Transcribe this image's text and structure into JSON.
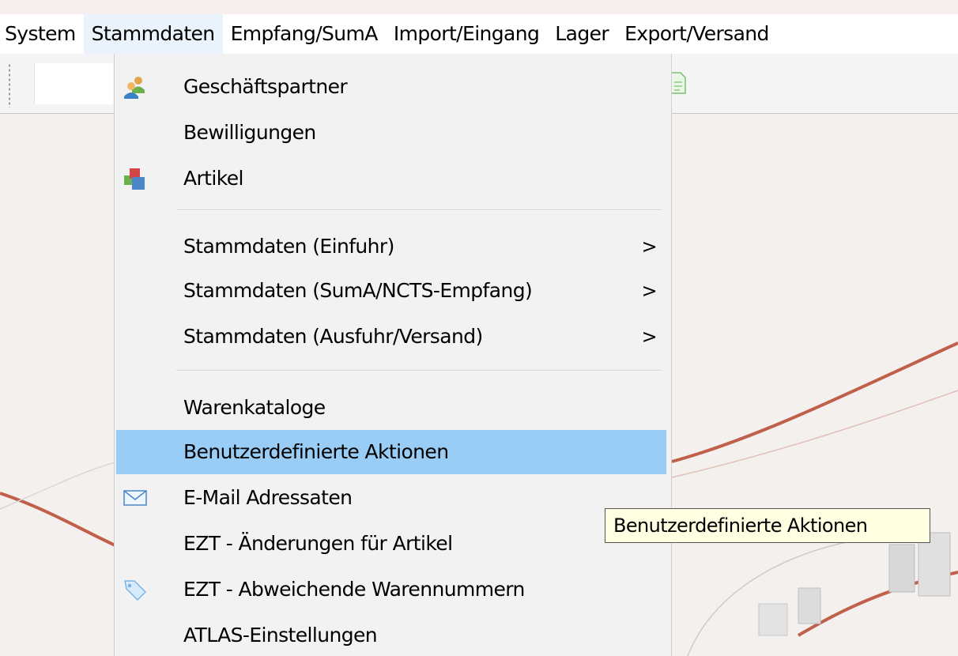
{
  "menubar": {
    "items": [
      {
        "label": "System"
      },
      {
        "label": "Stammdaten"
      },
      {
        "label": "Empfang/SumA"
      },
      {
        "label": "Import/Eingang"
      },
      {
        "label": "Lager"
      },
      {
        "label": "Export/Versand"
      }
    ],
    "active": "Stammdaten"
  },
  "dropdown": {
    "items": [
      {
        "label": "Geschäftspartner",
        "icon": "business-partner-icon"
      },
      {
        "label": "Bewilligungen"
      },
      {
        "label": "Artikel",
        "icon": "articles-cubes-icon"
      },
      {
        "label": "Stammdaten (Einfuhr)",
        "submenu_arrow": ">"
      },
      {
        "label": "Stammdaten (SumA/NCTS-Empfang)",
        "submenu_arrow": ">"
      },
      {
        "label": "Stammdaten (Ausfuhr/Versand)",
        "submenu_arrow": ">"
      },
      {
        "label": "Warenkataloge"
      },
      {
        "label": "Benutzerdefinierte Aktionen",
        "highlighted": true
      },
      {
        "label": "E-Mail Adressaten",
        "icon": "envelope-icon"
      },
      {
        "label": "EZT - Änderungen für Artikel"
      },
      {
        "label": "EZT - Abweichende Warennummern",
        "icon": "tag-icon"
      },
      {
        "label": "ATLAS-Einstellungen"
      }
    ]
  },
  "tooltip": {
    "text": "Benutzerdefinierte Aktionen"
  },
  "colors": {
    "highlight": "#99cdf5",
    "menu_background": "#f2f2f2",
    "tooltip_background": "#ffffe1",
    "desktop_curve": "#c0604a"
  }
}
